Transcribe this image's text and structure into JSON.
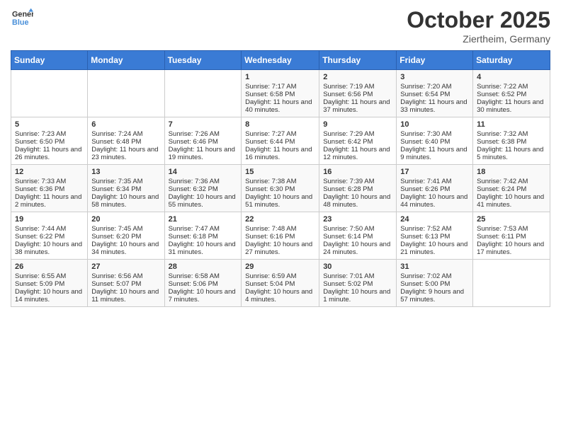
{
  "header": {
    "logo_line1": "General",
    "logo_line2": "Blue",
    "month": "October 2025",
    "location": "Ziertheim, Germany"
  },
  "weekdays": [
    "Sunday",
    "Monday",
    "Tuesday",
    "Wednesday",
    "Thursday",
    "Friday",
    "Saturday"
  ],
  "rows": [
    [
      {
        "day": "",
        "content": ""
      },
      {
        "day": "",
        "content": ""
      },
      {
        "day": "",
        "content": ""
      },
      {
        "day": "1",
        "content": "Sunrise: 7:17 AM\nSunset: 6:58 PM\nDaylight: 11 hours and 40 minutes."
      },
      {
        "day": "2",
        "content": "Sunrise: 7:19 AM\nSunset: 6:56 PM\nDaylight: 11 hours and 37 minutes."
      },
      {
        "day": "3",
        "content": "Sunrise: 7:20 AM\nSunset: 6:54 PM\nDaylight: 11 hours and 33 minutes."
      },
      {
        "day": "4",
        "content": "Sunrise: 7:22 AM\nSunset: 6:52 PM\nDaylight: 11 hours and 30 minutes."
      }
    ],
    [
      {
        "day": "5",
        "content": "Sunrise: 7:23 AM\nSunset: 6:50 PM\nDaylight: 11 hours and 26 minutes."
      },
      {
        "day": "6",
        "content": "Sunrise: 7:24 AM\nSunset: 6:48 PM\nDaylight: 11 hours and 23 minutes."
      },
      {
        "day": "7",
        "content": "Sunrise: 7:26 AM\nSunset: 6:46 PM\nDaylight: 11 hours and 19 minutes."
      },
      {
        "day": "8",
        "content": "Sunrise: 7:27 AM\nSunset: 6:44 PM\nDaylight: 11 hours and 16 minutes."
      },
      {
        "day": "9",
        "content": "Sunrise: 7:29 AM\nSunset: 6:42 PM\nDaylight: 11 hours and 12 minutes."
      },
      {
        "day": "10",
        "content": "Sunrise: 7:30 AM\nSunset: 6:40 PM\nDaylight: 11 hours and 9 minutes."
      },
      {
        "day": "11",
        "content": "Sunrise: 7:32 AM\nSunset: 6:38 PM\nDaylight: 11 hours and 5 minutes."
      }
    ],
    [
      {
        "day": "12",
        "content": "Sunrise: 7:33 AM\nSunset: 6:36 PM\nDaylight: 11 hours and 2 minutes."
      },
      {
        "day": "13",
        "content": "Sunrise: 7:35 AM\nSunset: 6:34 PM\nDaylight: 10 hours and 58 minutes."
      },
      {
        "day": "14",
        "content": "Sunrise: 7:36 AM\nSunset: 6:32 PM\nDaylight: 10 hours and 55 minutes."
      },
      {
        "day": "15",
        "content": "Sunrise: 7:38 AM\nSunset: 6:30 PM\nDaylight: 10 hours and 51 minutes."
      },
      {
        "day": "16",
        "content": "Sunrise: 7:39 AM\nSunset: 6:28 PM\nDaylight: 10 hours and 48 minutes."
      },
      {
        "day": "17",
        "content": "Sunrise: 7:41 AM\nSunset: 6:26 PM\nDaylight: 10 hours and 44 minutes."
      },
      {
        "day": "18",
        "content": "Sunrise: 7:42 AM\nSunset: 6:24 PM\nDaylight: 10 hours and 41 minutes."
      }
    ],
    [
      {
        "day": "19",
        "content": "Sunrise: 7:44 AM\nSunset: 6:22 PM\nDaylight: 10 hours and 38 minutes."
      },
      {
        "day": "20",
        "content": "Sunrise: 7:45 AM\nSunset: 6:20 PM\nDaylight: 10 hours and 34 minutes."
      },
      {
        "day": "21",
        "content": "Sunrise: 7:47 AM\nSunset: 6:18 PM\nDaylight: 10 hours and 31 minutes."
      },
      {
        "day": "22",
        "content": "Sunrise: 7:48 AM\nSunset: 6:16 PM\nDaylight: 10 hours and 27 minutes."
      },
      {
        "day": "23",
        "content": "Sunrise: 7:50 AM\nSunset: 6:14 PM\nDaylight: 10 hours and 24 minutes."
      },
      {
        "day": "24",
        "content": "Sunrise: 7:52 AM\nSunset: 6:13 PM\nDaylight: 10 hours and 21 minutes."
      },
      {
        "day": "25",
        "content": "Sunrise: 7:53 AM\nSunset: 6:11 PM\nDaylight: 10 hours and 17 minutes."
      }
    ],
    [
      {
        "day": "26",
        "content": "Sunrise: 6:55 AM\nSunset: 5:09 PM\nDaylight: 10 hours and 14 minutes."
      },
      {
        "day": "27",
        "content": "Sunrise: 6:56 AM\nSunset: 5:07 PM\nDaylight: 10 hours and 11 minutes."
      },
      {
        "day": "28",
        "content": "Sunrise: 6:58 AM\nSunset: 5:06 PM\nDaylight: 10 hours and 7 minutes."
      },
      {
        "day": "29",
        "content": "Sunrise: 6:59 AM\nSunset: 5:04 PM\nDaylight: 10 hours and 4 minutes."
      },
      {
        "day": "30",
        "content": "Sunrise: 7:01 AM\nSunset: 5:02 PM\nDaylight: 10 hours and 1 minute."
      },
      {
        "day": "31",
        "content": "Sunrise: 7:02 AM\nSunset: 5:00 PM\nDaylight: 9 hours and 57 minutes."
      },
      {
        "day": "",
        "content": ""
      }
    ]
  ]
}
